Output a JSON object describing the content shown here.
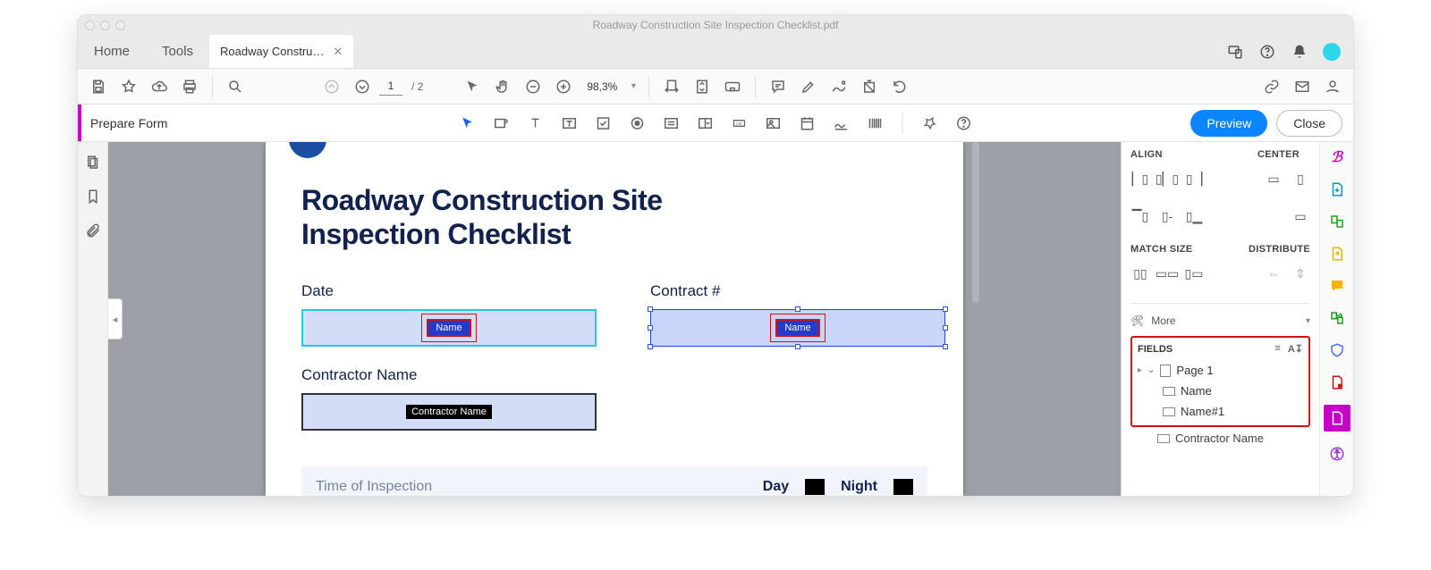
{
  "titlebar": {
    "title": "Roadway Construction Site Inspection Checklist.pdf"
  },
  "tabs": {
    "home": "Home",
    "tools": "Tools",
    "doc": "Roadway Constru…"
  },
  "toolbar": {
    "page_current": "1",
    "page_total": "/ 2",
    "zoom": "98,3%"
  },
  "formbar": {
    "label": "Prepare Form",
    "preview": "Preview",
    "close": "Close"
  },
  "document": {
    "title_line1": "Roadway Construction Site",
    "title_line2": "Inspection Checklist",
    "date_label": "Date",
    "contract_label": "Contract #",
    "contractor_label": "Contractor Name",
    "field_name_tag": "Name",
    "field_contractor_tag": "Contractor Name",
    "time_section": "Time of Inspection",
    "day": "Day",
    "night": "Night"
  },
  "rightpanel": {
    "align": "ALIGN",
    "center": "CENTER",
    "matchsize": "MATCH SIZE",
    "distribute": "DISTRIBUTE",
    "more": "More",
    "fields": "FIELDS",
    "page1": "Page 1",
    "f_name": "Name",
    "f_name1": "Name#1",
    "f_contractor": "Contractor Name"
  }
}
